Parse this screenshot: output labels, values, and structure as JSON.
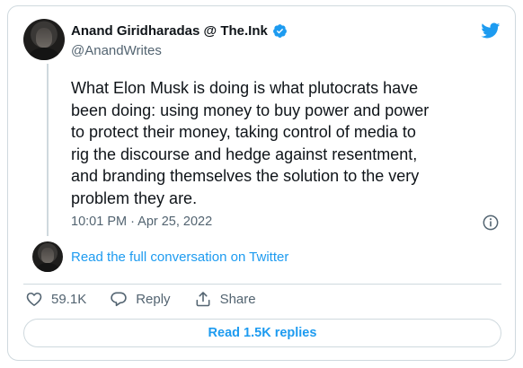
{
  "author": {
    "display_name": "Anand Giridharadas @ The.Ink",
    "handle": "@AnandWrites"
  },
  "tweet": {
    "text": "What Elon Musk is doing is what plutocrats have\nbeen doing: using money to buy power and power\nto protect their money, taking control of media to\nrig the discourse and hedge against resentment,\nand branding themselves the solution to the very\nproblem they are.",
    "timestamp": "10:01 PM · Apr 25, 2022"
  },
  "conversation": {
    "link_label": "Read the full conversation on Twitter"
  },
  "actions": {
    "like_count": "59.1K",
    "reply_label": "Reply",
    "share_label": "Share"
  },
  "replies_button": {
    "label": "Read 1.5K replies"
  },
  "icons": {
    "brand": "twitter-bird-icon",
    "verified": "verified-badge-icon",
    "info": "info-icon",
    "like": "heart-icon",
    "reply": "reply-bubble-icon",
    "share": "share-icon"
  },
  "colors": {
    "accent": "#1d9bf0",
    "text": "#0f1419",
    "secondary": "#536471",
    "border": "#cfd9de"
  }
}
